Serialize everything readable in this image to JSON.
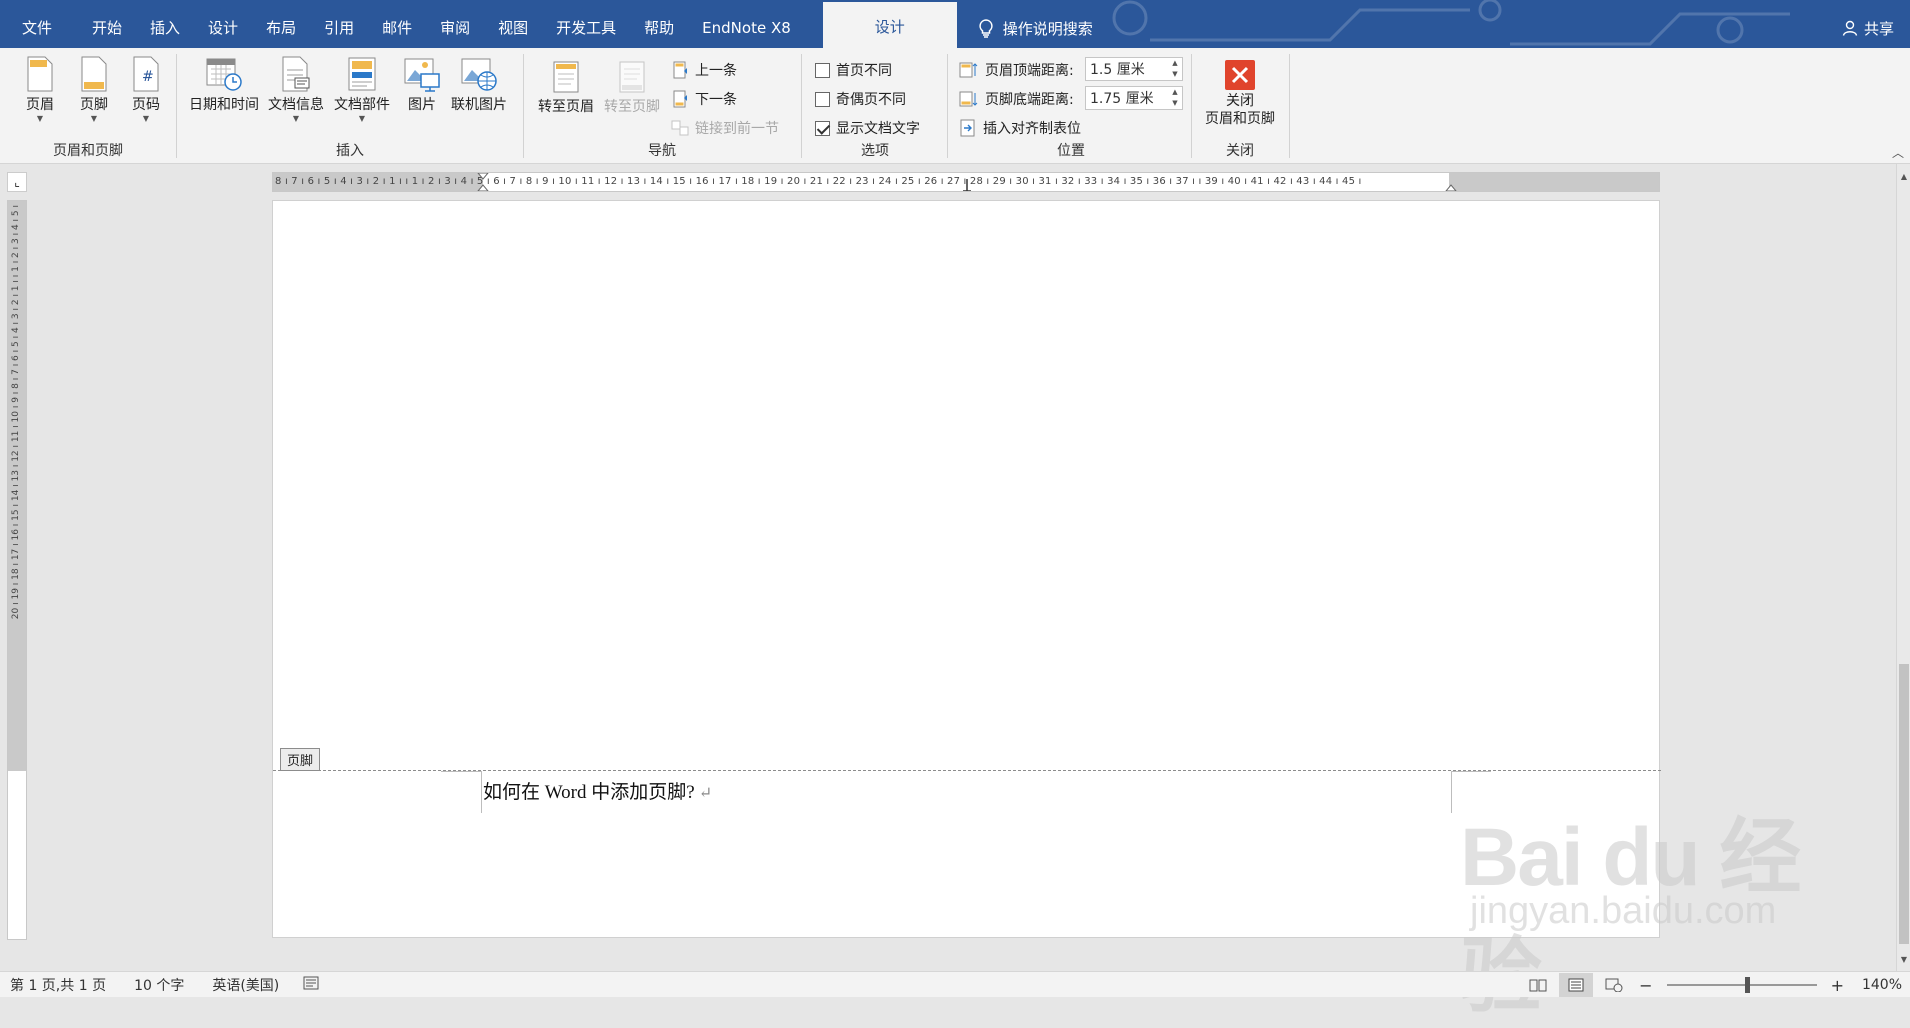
{
  "tabs": {
    "file": "文件",
    "home": "开始",
    "insert": "插入",
    "design": "设计",
    "layout": "布局",
    "references": "引用",
    "mailings": "邮件",
    "review": "审阅",
    "view": "视图",
    "developer": "开发工具",
    "help": "帮助",
    "endnote": "EndNote X8",
    "hf_design": "设计",
    "search": "操作说明搜索",
    "share": "共享"
  },
  "ribbon": {
    "hf_group": {
      "name": "页眉和页脚",
      "header": "页眉",
      "footer": "页脚",
      "page_number": "页码"
    },
    "insert_group": {
      "name": "插入",
      "date_time": "日期和时间",
      "doc_info": "文档信息",
      "quick_parts": "文档部件",
      "picture": "图片",
      "online_picture": "联机图片"
    },
    "nav_group": {
      "name": "导航",
      "goto_header": "转至页眉",
      "goto_footer": "转至页脚",
      "previous": "上一条",
      "next": "下一条",
      "link_previous": "链接到前一节"
    },
    "options_group": {
      "name": "选项",
      "diff_first": "首页不同",
      "diff_odd_even": "奇偶页不同",
      "show_doc_text": "显示文档文字"
    },
    "options_state": {
      "diff_first": false,
      "diff_odd_even": false,
      "show_doc_text": true
    },
    "position_group": {
      "name": "位置",
      "header_top_label": "页眉顶端距离:",
      "header_top_value": "1.5 厘米",
      "footer_bottom_label": "页脚底端距离:",
      "footer_bottom_value": "1.75 厘米",
      "insert_align_tab": "插入对齐制表位"
    },
    "close_group": {
      "name": "关闭",
      "close_line1": "关闭",
      "close_line2": "页眉和页脚"
    }
  },
  "ruler": {
    "horizontal_ticks": "8 ı 7 ı 6 ı 5 ı 4 ı 3 ı 2 ı 1 ı  ı 1 ı 2 ı 3 ı 4 ı 5 ı 6 ı 7 ı 8 ı 9 ı 10 ı 11 ı 12 ı 13 ı 14 ı 15 ı 16 ı 17 ı 18 ı 19 ı 20 ı 21 ı 22 ı 23 ı 24 ı 25 ı 26 ı 27 ı 28 ı 29 ı 30 ı 31 ı 32 ı 33 ı 34 ı 35 ı 36 ı 37 ı  ı 39 ı 40 ı 41 ı 42 ı 43 ı 44 ı 45 ı",
    "vertical_ticks": "20 ı 19 ı 18 ı 17 ı 16 ı 15 ı 14 ı 13 ı 12 ı 11 ı 10 ı 9 ı 8 ı 7 ı 6 ı 5 ı 4 ı 3 ı 2 ı 1 ı  ı 1 ı 2 ı 3 ı 4 ı 5 ı"
  },
  "document": {
    "footer_tag": "页脚",
    "footer_text": "如何在 Word 中添加页脚?",
    "paragraph_mark": "↵"
  },
  "statusbar": {
    "page": "第 1 页,共 1 页",
    "words": "10 个字",
    "language": "英语(美国)",
    "zoom_minus": "−",
    "zoom_plus": "+",
    "zoom": "140%"
  },
  "watermark": {
    "brand": "Bai du 经验",
    "url": "jingyan.baidu.com"
  },
  "colors": {
    "accent": "#2b579a",
    "ribbon_bg": "#f3f3f3",
    "close_red": "#e0442c"
  }
}
